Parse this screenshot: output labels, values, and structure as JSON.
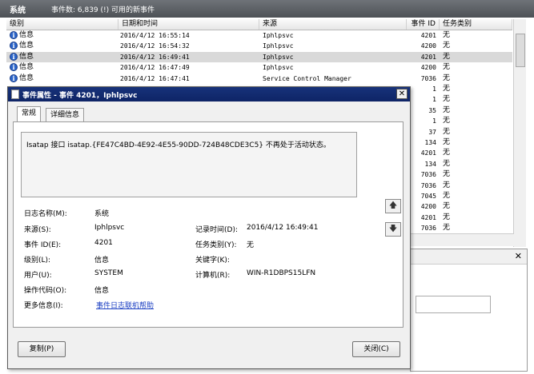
{
  "eventviewer": {
    "section": "系统",
    "event_count": "事件数: 6,839 (!) 可用的新事件",
    "columns": [
      "级别",
      "日期和时间",
      "来源",
      "事件 ID",
      "任务类别"
    ],
    "rows": [
      {
        "level": "信息",
        "datetime": "2016/4/12 16:55:14",
        "source": "Iphlpsvc",
        "id": "4201",
        "task": "无"
      },
      {
        "level": "信息",
        "datetime": "2016/4/12 16:54:32",
        "source": "Iphlpsvc",
        "id": "4200",
        "task": "无"
      },
      {
        "level": "信息",
        "datetime": "2016/4/12 16:49:41",
        "source": "Iphlpsvc",
        "id": "4201",
        "task": "无"
      },
      {
        "level": "信息",
        "datetime": "2016/4/12 16:47:49",
        "source": "Iphlpsvc",
        "id": "4200",
        "task": "无"
      },
      {
        "level": "信息",
        "datetime": "2016/4/12 16:47:41",
        "source": "Service Control Manager",
        "id": "7036",
        "task": "无"
      },
      {
        "level": "",
        "datetime": "",
        "source": "",
        "id": "1",
        "task": "无"
      },
      {
        "level": "",
        "datetime": "",
        "source": "",
        "id": "1",
        "task": "无"
      },
      {
        "level": "",
        "datetime": "",
        "source": "",
        "id": "35",
        "task": "无"
      },
      {
        "level": "",
        "datetime": "",
        "source": "",
        "id": "1",
        "task": "无"
      },
      {
        "level": "",
        "datetime": "",
        "source": "",
        "id": "37",
        "task": "无"
      },
      {
        "level": "",
        "datetime": "",
        "source": "",
        "id": "134",
        "task": "无"
      },
      {
        "level": "",
        "datetime": "",
        "source": "",
        "id": "4201",
        "task": "无"
      },
      {
        "level": "",
        "datetime": "",
        "source": "",
        "id": "134",
        "task": "无"
      },
      {
        "level": "",
        "datetime": "",
        "source": "",
        "id": "7036",
        "task": "无"
      },
      {
        "level": "",
        "datetime": "",
        "source": "",
        "id": "7036",
        "task": "无"
      },
      {
        "level": "",
        "datetime": "",
        "source": "",
        "id": "7045",
        "task": "无"
      },
      {
        "level": "",
        "datetime": "",
        "source": "",
        "id": "4200",
        "task": "无"
      },
      {
        "level": "",
        "datetime": "",
        "source": "",
        "id": "4201",
        "task": "无"
      },
      {
        "level": "",
        "datetime": "",
        "source": "",
        "id": "7036",
        "task": "无"
      }
    ],
    "lower_close": "✕"
  },
  "dialog": {
    "title": "事件属性 - 事件 4201，Iphlpsvc",
    "close": "✕",
    "tabs": [
      "常规",
      "详细信息"
    ],
    "description": "Isatap 接口 isatap.{FE47C4BD-4E92-4E55-90DD-724B48CDE3C5} 不再处于活动状态。",
    "fields": {
      "log_name_label": "日志名称(M):",
      "log_name": "系统",
      "source_label": "来源(S):",
      "source": "Iphlpsvc",
      "logged_label": "记录时间(D):",
      "logged": "2016/4/12 16:49:41",
      "event_id_label": "事件 ID(E):",
      "event_id": "4201",
      "task_label": "任务类别(Y):",
      "task": "无",
      "level_label": "级别(L):",
      "level": "信息",
      "keywords_label": "关键字(K):",
      "keywords": "",
      "user_label": "用户(U):",
      "user": "SYSTEM",
      "computer_label": "计算机(R):",
      "computer": "WIN-R1DBPS15LFN",
      "opcode_label": "操作代码(O):",
      "opcode": "信息",
      "more_info_label": "更多信息(I):",
      "more_info_link": "事件日志联机帮助"
    },
    "copy_button": "复制(P)",
    "close_button": "关闭(C)",
    "colors": {
      "titlebar": "#0e2466",
      "link": "#1a3ec2"
    }
  }
}
